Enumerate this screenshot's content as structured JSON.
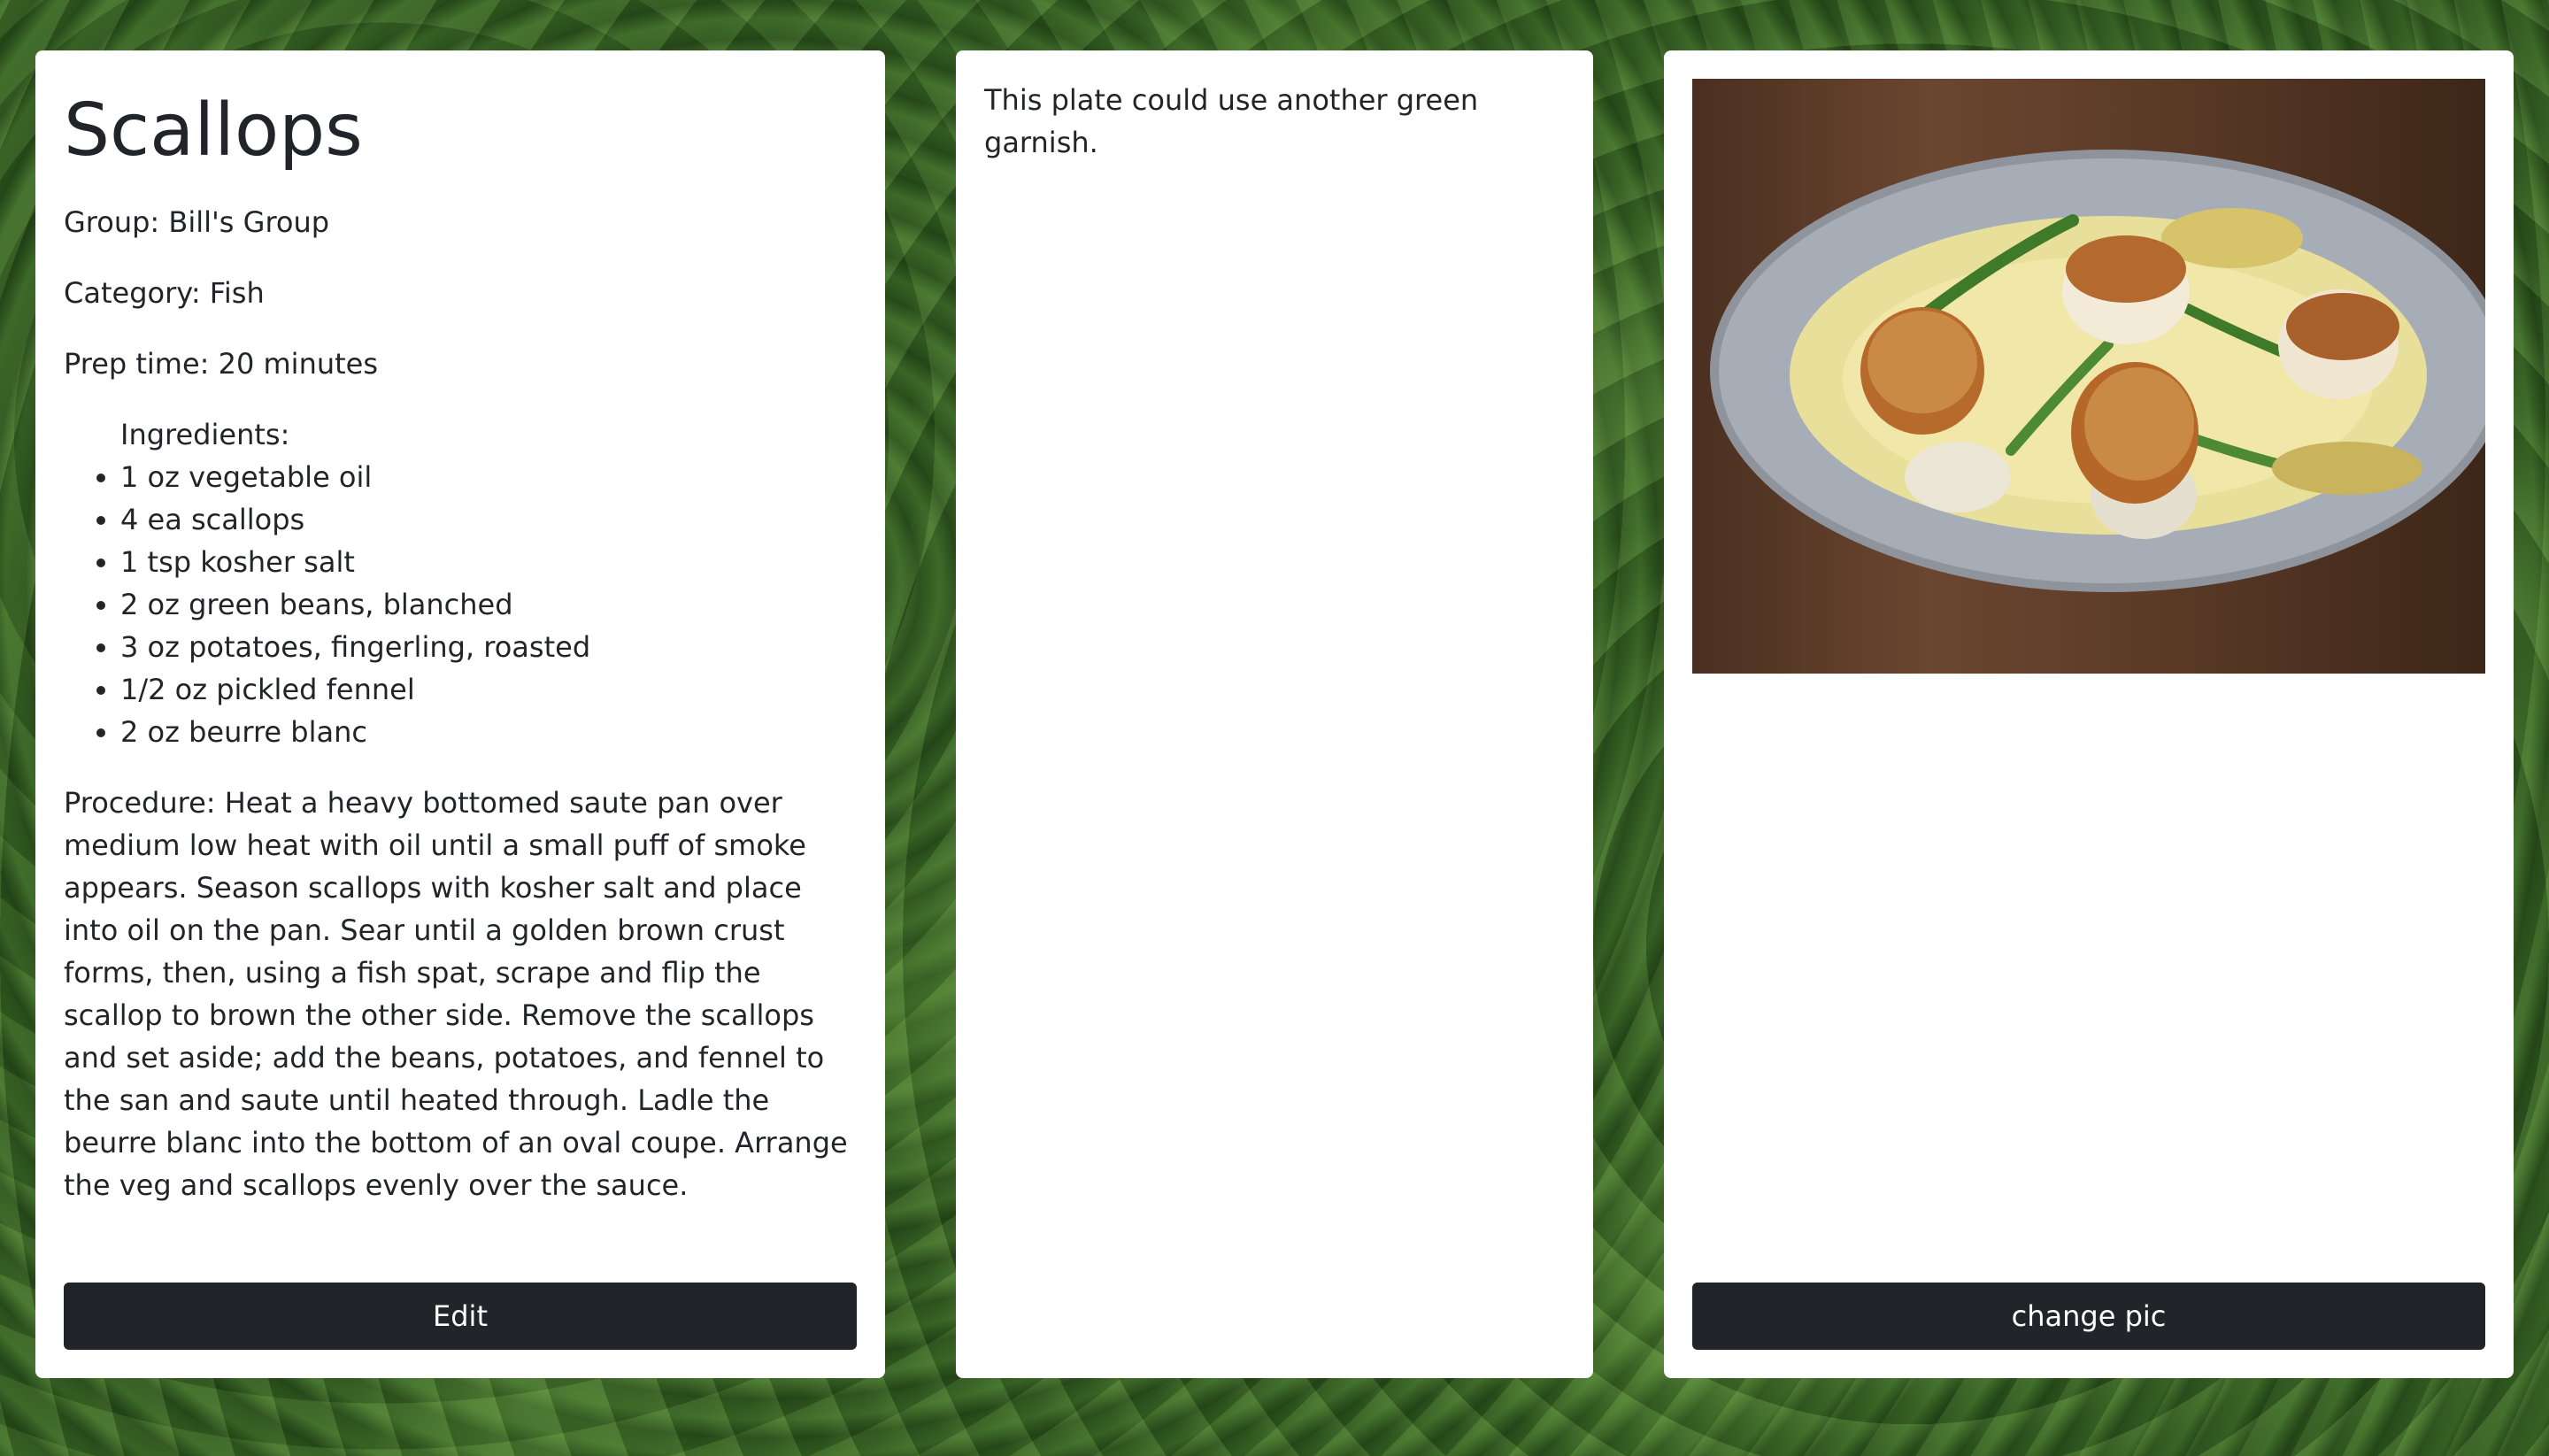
{
  "recipe": {
    "title": "Scallops",
    "group": "Group: Bill's Group",
    "category": "Category: Fish",
    "prep_time": "Prep time: 20 minutes",
    "ingredients_label": "Ingredients:",
    "ingredients": [
      "1 oz vegetable oil",
      "4 ea scallops",
      "1 tsp kosher salt",
      "2 oz green beans, blanched",
      "3 oz potatoes, fingerling, roasted",
      "1/2 oz pickled fennel",
      "2 oz beurre blanc"
    ],
    "procedure": "Procedure: Heat a heavy bottomed saute pan over medium low heat with oil until a small puff of smoke appears. Season scallops with kosher salt and place into oil on the pan. Sear until a golden brown crust forms, then, using a fish spat, scrape and flip the scallop to brown the other side. Remove the scallops and set aside; add the beans, potatoes, and fennel to the san and saute until heated through. Ladle the beurre blanc into the bottom of an oval coupe. Arrange the veg and scallops evenly over the sauce.",
    "edit_label": "Edit"
  },
  "notes": {
    "text": "This plate could use another green garnish."
  },
  "photo": {
    "change_label": "change pic"
  },
  "colors": {
    "button_bg": "#212529",
    "card_bg": "#ffffff"
  }
}
